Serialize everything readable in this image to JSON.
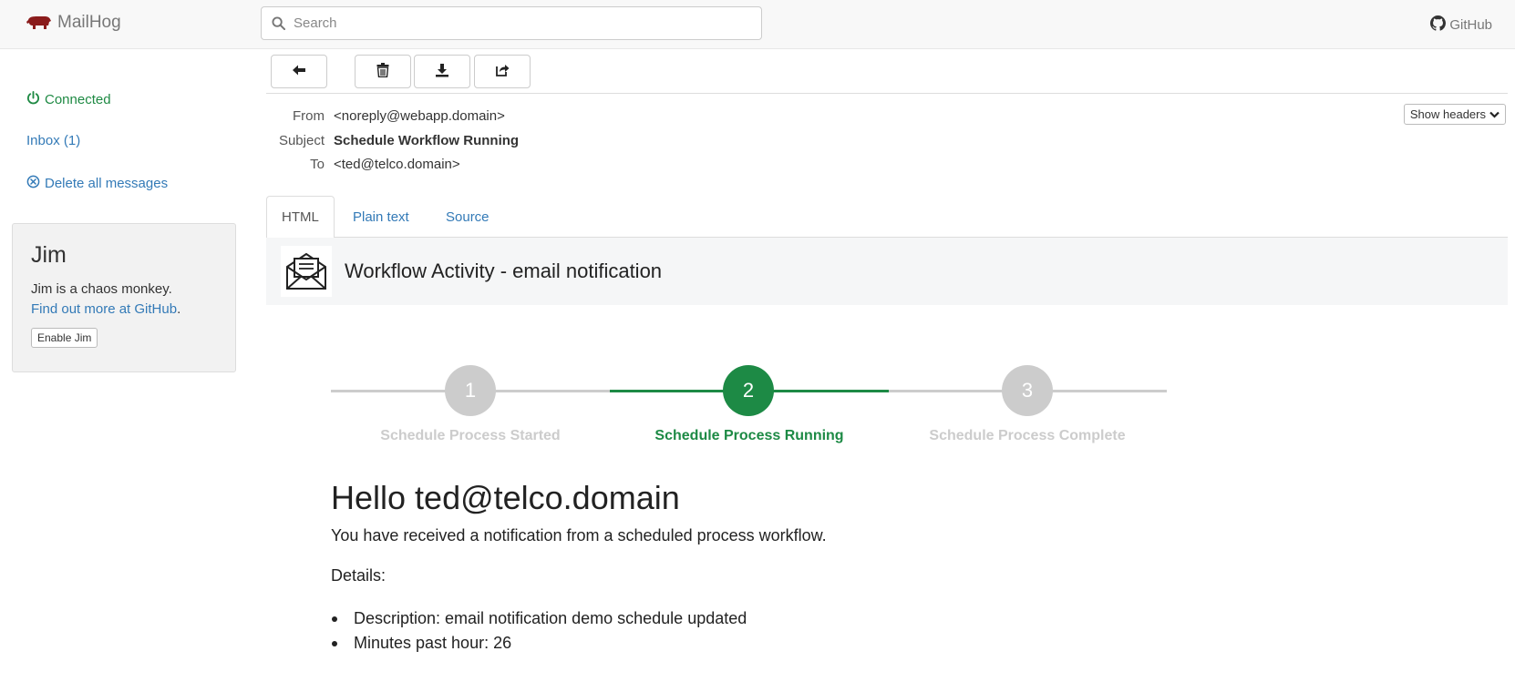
{
  "navbar": {
    "brand": "MailHog",
    "search_placeholder": "Search",
    "github_label": "GitHub"
  },
  "sidebar": {
    "connected": "Connected",
    "inbox": "Inbox (1)",
    "delete_all": "Delete all messages",
    "jim": {
      "title": "Jim",
      "description": "Jim is a chaos monkey.",
      "link_text": "Find out more at GitHub",
      "link_suffix": ".",
      "button": "Enable Jim"
    }
  },
  "toolbar": {
    "buttons": [
      "back-arrow-icon",
      "trash-icon",
      "download-icon",
      "share-icon"
    ]
  },
  "headers": {
    "from_label": "From",
    "from_value": "<noreply@webapp.domain>",
    "subject_label": "Subject",
    "subject_value": "Schedule Workflow Running",
    "to_label": "To",
    "to_value": "<ted@telco.domain>",
    "show_headers": "Show headers"
  },
  "tabs": [
    "HTML",
    "Plain text",
    "Source"
  ],
  "email": {
    "banner_title": "Workflow Activity - email notification",
    "steps": [
      {
        "number": "1",
        "label": "Schedule Process Started",
        "active": false
      },
      {
        "number": "2",
        "label": "Schedule Process Running",
        "active": true
      },
      {
        "number": "3",
        "label": "Schedule Process Complete",
        "active": false
      }
    ],
    "greeting": "Hello ted@telco.domain",
    "intro": "You have received a notification from a scheduled process workflow.",
    "details_label": "Details:",
    "details": [
      "Description: email notification demo schedule updated",
      "Minutes past hour: 26"
    ]
  },
  "colors": {
    "link": "#337ab7",
    "success": "#1d8a45",
    "inactive_step": "#cccccc",
    "brand_icon": "#8b1c1c"
  }
}
